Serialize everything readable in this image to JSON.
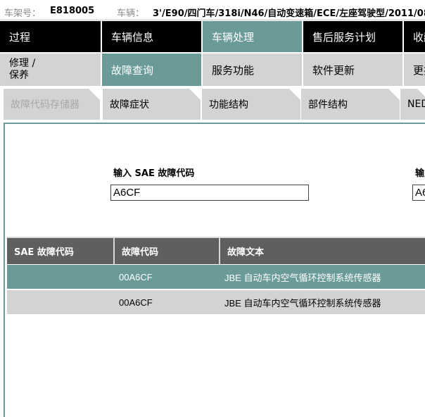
{
  "header": {
    "chassis_label": "车架号：",
    "chassis_value": "E818005",
    "vehicle_label": "车辆：",
    "vehicle_value": "3'/E90/四门车/318i/N46/自动变速箱/ECE/左座驾驶型/2011/08"
  },
  "nav_main": [
    {
      "label": "过程"
    },
    {
      "label": "车辆信息"
    },
    {
      "label": "车辆处理"
    },
    {
      "label": "售后服务计划"
    },
    {
      "label": "收藏"
    }
  ],
  "nav_sub": [
    {
      "label_line1": "修理 /",
      "label_line2": "保养"
    },
    {
      "label": "故障查询"
    },
    {
      "label": "服务功能"
    },
    {
      "label": "软件更新"
    },
    {
      "label": "更换"
    }
  ],
  "tabs": [
    {
      "label": "故障代码存储器"
    },
    {
      "label": "故障症状"
    },
    {
      "label": "功能结构"
    },
    {
      "label": "部件结构"
    },
    {
      "label": "NED"
    }
  ],
  "form": {
    "sae_label": "输入 SAE 故障代码",
    "sae_value": "A6CF",
    "second_label": "输入",
    "second_value": "A6"
  },
  "table": {
    "columns": [
      "SAE 故障代码",
      "故障代码",
      "故障文本"
    ],
    "rows": [
      {
        "sae": "",
        "code": "00A6CF",
        "text": "JBE 自动车内空气循环控制系统传感器"
      },
      {
        "sae": "",
        "code": "00A6CF",
        "text": "JBE 自动车内空气循环控制系统传感器"
      }
    ]
  },
  "colors": {
    "accent": "#6a9b99",
    "nav_bg": "#000000",
    "tab_bg": "#d3d3d3",
    "table_header": "#5f5f5f"
  }
}
